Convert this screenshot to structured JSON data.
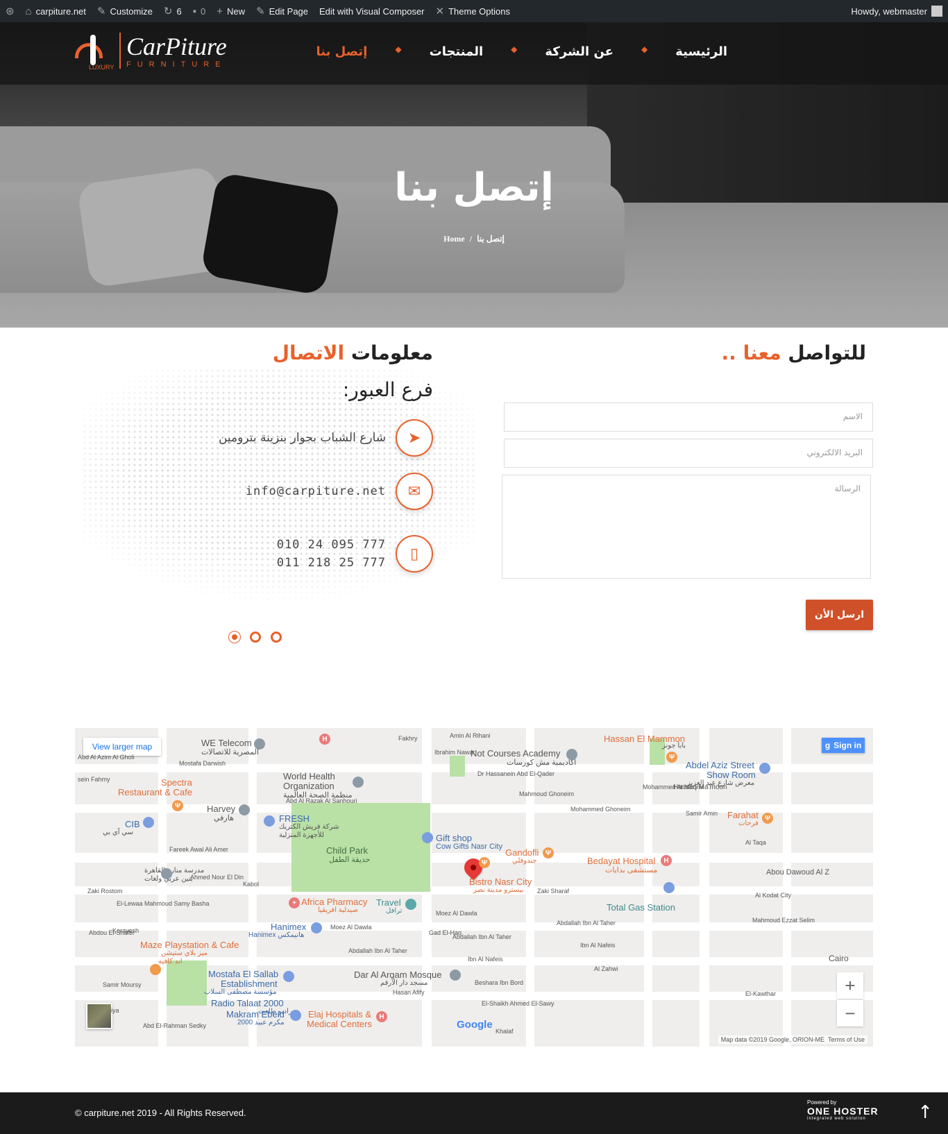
{
  "adminbar": {
    "wp_icon": "wordpress-icon",
    "site": "carpiture.net",
    "customize": "Customize",
    "updates": "6",
    "comments": "0",
    "new": "New",
    "edit_page": "Edit Page",
    "visual_composer": "Edit with Visual Composer",
    "theme_options": "Theme Options",
    "howdy": "Howdy, webmaster"
  },
  "logo": {
    "name": "CarPiture",
    "sub": "FURNITURE",
    "lux": "LUXURY"
  },
  "menu": [
    "الرئيسية",
    "عن الشركة",
    "المنتجات",
    "إتصل بنا"
  ],
  "hero": {
    "title": "إتصل بنا",
    "breadcrumb_home": "Home",
    "breadcrumb_sep": "/",
    "breadcrumb_current": "إتصل بنا"
  },
  "contact_form": {
    "title_main": "للتواصل",
    "title_accent": "معنا",
    "title_tail": "..",
    "name_placeholder": "الاسم",
    "email_placeholder": "البريد الالكتروني",
    "message_placeholder": "الرسالة",
    "send_label": "ارسل الأن"
  },
  "contact_info": {
    "title_main": "معلومات",
    "title_accent": "الاتصال",
    "branch": "فرع العبور:",
    "address": "شارع الشباب بجوار بنزينة بترومين",
    "email": "info@carpiture.net",
    "phone1": "010 24 095 777",
    "phone2": "011 218 25 777"
  },
  "map": {
    "view_larger": "View larger map",
    "sign_in": "Sign in",
    "data": "Map data ©2019 Google, ORION-ME",
    "terms": "Terms of Use",
    "google": "Google",
    "labels": {
      "we": "WE Telecom",
      "we_ar": "المصرية للاتصالات",
      "who": "World Health",
      "who2": "Organization",
      "who_ar": "منظمة الصحة العالمية",
      "not_courses": "Not Courses Academy",
      "not_courses_ar": "اكاديمية مش كورسات",
      "hassan": "Hassan El Mammon",
      "hassan_ar": "بابا جونز",
      "abdel_aziz": "Abdel Aziz Street",
      "show_room": "Show Room",
      "abdel_aziz_ar": "معرض شارع عبد العزيز",
      "spectra": "Spectra",
      "spectra2": "Restaurant & Cafe",
      "harvey": "Harvey",
      "harvey_ar": "هارفي",
      "fresh": "FRESH",
      "fresh_ar": "شركة فريش الكتريك",
      "fresh_ar2": "للأجهزة المنزلية",
      "cib": "CIB",
      "cib_ar": "سي آي بي",
      "child_park": "Child Park",
      "child_park_ar": "حديقة الطفل",
      "gift": "Gift shop",
      "gift2": "Cow Gifts Nasr City",
      "gandofli": "Gandofli",
      "gandofli_ar": "جندوفلي",
      "bedayat": "Bedayat Hospital",
      "bedayat_ar": "مستشفى بدايات",
      "farahat": "Farahat",
      "farahat_ar": "فرحات",
      "bistro": "Bistro Nasr City",
      "bistro_ar": "بيسترو مدينة نصر",
      "africa": "Africa Pharmacy",
      "africa_ar": "صيدلية افريقيا",
      "travel": "Travel",
      "travel_ar": "ترافل",
      "total": "Total Gas Station",
      "hanimex": "Hanimex",
      "hanimex2": "Hanimex هانيمكس",
      "maze": "Maze Playstation & Cafe",
      "maze_ar": "ميز بلاي ستيشن",
      "maze_ar2": "اند كافيه",
      "sallab": "Mostafa El Sallab",
      "sallab2": "Establishment",
      "sallab_ar": "مؤسسة مصطفى السلاب",
      "radio": "Radio Talaat 2000",
      "radio_ar": "راديو طلعت",
      "makram": "Makram Ebeid",
      "makram_ar": "2000 مكرم عبيد",
      "elaj": "Elaj Hospitals &",
      "elaj2": "Medical Centers",
      "arqam": "Dar Al Arqam Mosque",
      "arqam_ar": "مسجد دار الأرقم",
      "cairo": "Cairo",
      "school": "مدرسة منارة القاهرة",
      "school2": "بنين عربي ولغات",
      "st_abd_azim": "Abd Al Azim Al Gholi",
      "st_fahmy": "sein Fahmy",
      "st_darwish": "Mostafa Darwish",
      "st_razak": "Abd Al Razak Al Sanhouri",
      "st_fakhry": "Fakhry",
      "st_ibrahim": "Ibrahim Nawar",
      "st_amin": "Amin Al Rihani",
      "st_qader": "Dr Hassanein Abd El-Qader",
      "st_ghoneim": "Mahmoud Ghoneim",
      "st_ghoneim2": "Mohammed Ghoneim",
      "st_maqref": "Mohammed Al Maqref",
      "st_mamoon": "Hassan Ma'moon",
      "st_samir": "Samir Amin",
      "st_taqa": "Al Taqa",
      "st_fareek": "Fareek Awal Ali Amer",
      "st_nour": "Ahmed Nour El Din",
      "st_kabol": "Kabol",
      "st_zaki": "Zaki Rostom",
      "st_lewaa": "El-Lewaa Mahmoud Samy Basha",
      "st_moez": "Moez Al Dawla",
      "st_moez2": "Moez Al Dawla",
      "st_gad": "Gad El-Haq",
      "st_zaki_sharaf": "Zaki Sharaf",
      "st_taher": "Abdallah Ibn Al Taher",
      "st_taher2": "Abdallah Ibn Al Taher",
      "st_taher3": "Abdallah Ibn Al Taher",
      "st_nafeis": "Ibn Al Nafeis",
      "st_nafeis2": "Ibn Al Nafeis",
      "st_zahwi": "Al Zahwi",
      "st_kawthar": "El-Kawthar",
      "st_bord": "Beshara Ibn Bord",
      "st_sawy": "El-Shaikh Ahmed El-Sawy",
      "st_afify": "Hasan Afify",
      "st_abou": "Abou Dawoud Al Z",
      "st_kodat": "Al Kodat City",
      "st_ezzat": "Mahmoud Ezzat Selim",
      "st_selim": "Ezzat Selim",
      "st_korayesh": "Korayesh",
      "st_shafei": "Abdou El-Shafei",
      "st_moursy": "Samir Moursy",
      "st_sedky": "Abd El-Rahman Sedky",
      "st_khalaf": "Khalaf",
      "st_iya": "iya"
    }
  },
  "footer": {
    "copyright": "© carpiture.net 2019 - All Rights Reserved.",
    "powered": "Powered by",
    "brand": "ONE HOSTER",
    "tagline": "integrated web solution"
  }
}
